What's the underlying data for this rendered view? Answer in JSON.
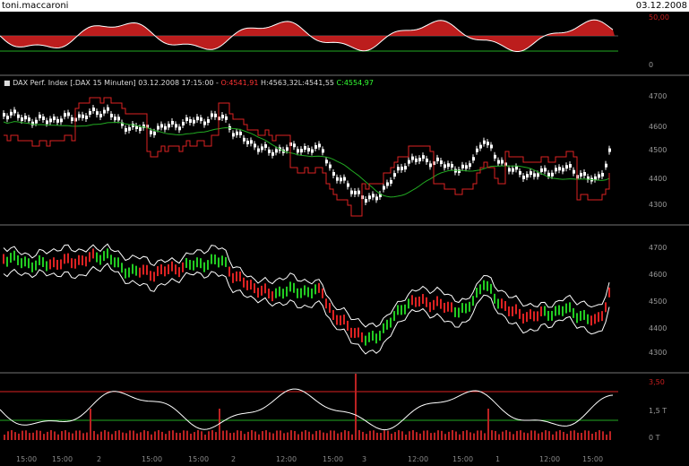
{
  "window": {
    "user": "toni.maccaroni",
    "date": "03.12.2008"
  },
  "legend": {
    "name": "DAX Perf. Index [.DAX  15 Minuten] 03.12.2008 17:15:00 - ",
    "open": "O:4541,91",
    "high": "H:4563,32",
    "low": "L:4541,55",
    "close": "C:4554,97"
  },
  "axes": {
    "osc_top": {
      "ticks": [
        "0"
      ],
      "header": "50,00"
    },
    "price_top": {
      "ticks": [
        "4700",
        "4600",
        "4500",
        "4400",
        "4300"
      ]
    },
    "price_mid": {
      "ticks": [
        "4700",
        "4600",
        "4500",
        "4400",
        "4300"
      ]
    },
    "volume": {
      "ticks": [
        "3,50",
        "1,5 T",
        "0 T"
      ]
    }
  },
  "time_labels": [
    "15:00",
    "15:00",
    "2",
    "15:00",
    "15:00",
    "2",
    "12:00",
    "15:00",
    "3",
    "12:00",
    "15:00",
    "1",
    "12:00",
    "15:00"
  ],
  "colors": {
    "up": "#22cc22",
    "down": "#dd2222",
    "line": "#ffffff",
    "ma": "#22aa22",
    "stop": "#dd2222"
  }
}
